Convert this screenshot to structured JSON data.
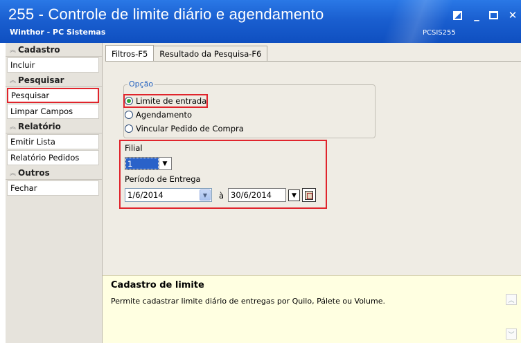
{
  "window": {
    "title": "255 - Controle de limite diário e agendamento",
    "subtitle": "Winthor - PC Sistemas",
    "code": "PCSIS255"
  },
  "sidebar": {
    "sections": [
      {
        "title": "Cadastro",
        "items": [
          {
            "label": "Incluir"
          }
        ]
      },
      {
        "title": "Pesquisar",
        "items": [
          {
            "label": "Pesquisar"
          },
          {
            "label": "Limpar Campos"
          }
        ]
      },
      {
        "title": "Relatório",
        "items": [
          {
            "label": "Emitir Lista"
          },
          {
            "label": "Relatório Pedidos"
          }
        ]
      },
      {
        "title": "Outros",
        "items": [
          {
            "label": "Fechar"
          }
        ]
      }
    ]
  },
  "tabs": [
    {
      "label": "Filtros-F5"
    },
    {
      "label": "Resultado da Pesquisa-F6"
    }
  ],
  "opcao": {
    "label": "Opção",
    "options": [
      {
        "label": "Limite de entrada",
        "checked": true
      },
      {
        "label": "Agendamento",
        "checked": false
      },
      {
        "label": "Vincular Pedido de Compra",
        "checked": false
      }
    ]
  },
  "filial": {
    "label": "Filial",
    "value": "1"
  },
  "periodo": {
    "label": "Período de Entrega",
    "start": "1/6/2014",
    "separator": "à",
    "end": "30/6/2014"
  },
  "description": {
    "title": "Cadastro de limite",
    "text": "Permite cadastrar limite diário de entregas por Quilo, Pálete ou Volume."
  },
  "colors": {
    "highlight": "#e0242c",
    "titlebar": "#1a5fd0",
    "panel": "#efece4",
    "desc_bg": "#ffffe1"
  }
}
